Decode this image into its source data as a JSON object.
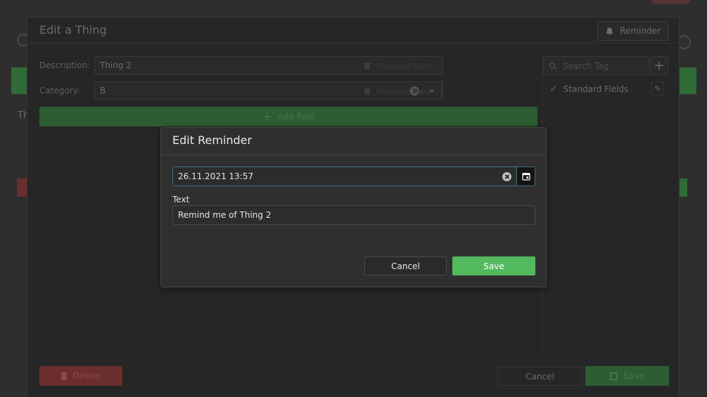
{
  "thing_modal": {
    "title": "Edit a Thing",
    "reminder_button": "Reminder",
    "description_label": "Description:",
    "description_value": "Thing 2",
    "category_label": "Category:",
    "category_value": "B",
    "standard_field_badge": "Standard Field",
    "add_field_button": "Add field",
    "tag_search_placeholder": "Search Tag",
    "tags": [
      {
        "label": "Standard Fields",
        "checked": true
      }
    ],
    "delete_button": "Delete",
    "cancel_button": "Cancel",
    "save_button": "Save"
  },
  "background": {
    "letters": "Th"
  },
  "reminder_dialog": {
    "title": "Edit Reminder",
    "date_value": "26.11.2021 13:57",
    "text_label": "Text",
    "text_value": "Remind me of Thing 2",
    "cancel_button": "Cancel",
    "save_button": "Save"
  },
  "colors": {
    "accent_green": "#53b95e",
    "focus_border": "#3e6f7e",
    "danger_red": "#6a2e2e"
  },
  "icons": {
    "reminder": "bell-icon",
    "add_field": "plus-icon",
    "search": "search-icon",
    "tag_add": "plus-icon",
    "tag_check": "check-icon",
    "tag_edit": "pencil-icon",
    "delete": "trash-icon",
    "save": "floppy-disk-icon",
    "date_clear": "clear-icon",
    "calendar": "calendar-icon"
  }
}
